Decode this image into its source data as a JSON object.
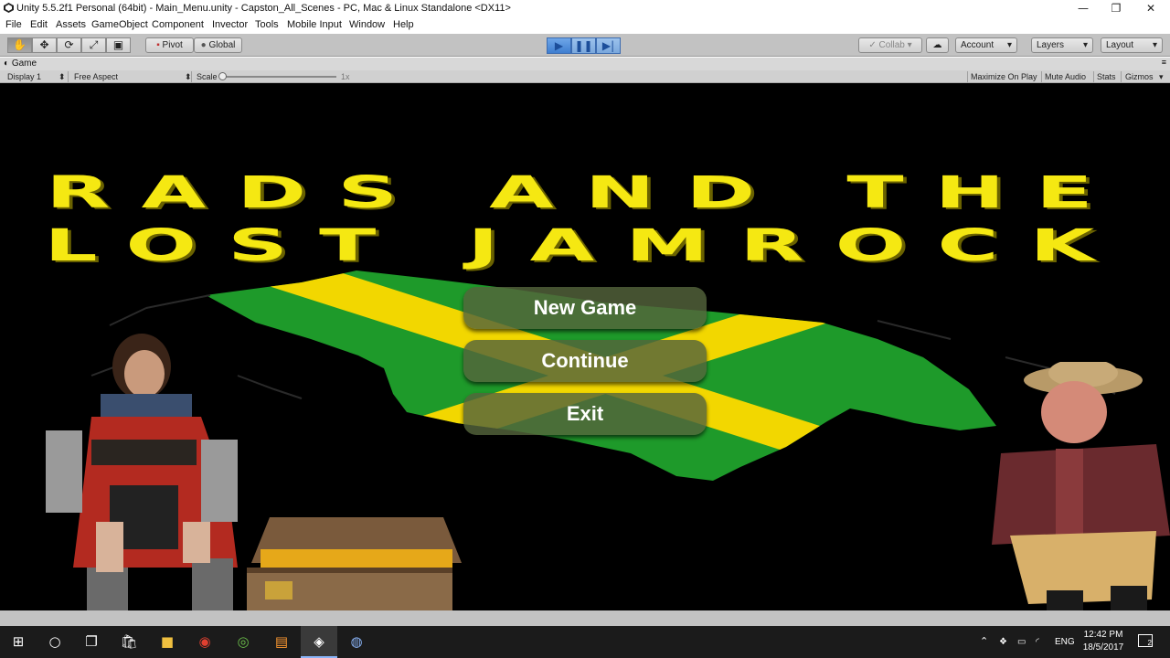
{
  "window": {
    "title": "Unity 5.5.2f1 Personal (64bit) - Main_Menu.unity - Capston_All_Scenes - PC, Mac & Linux Standalone <DX11>",
    "minimize_glyph": "—",
    "maximize_glyph": "❐",
    "close_glyph": "✕"
  },
  "menu": [
    "File",
    "Edit",
    "Assets",
    "GameObject",
    "Component",
    "Invector",
    "Tools",
    "Mobile Input",
    "Window",
    "Help"
  ],
  "toolbar": {
    "tools": [
      "✋",
      "✥",
      "⟳",
      "⤢",
      "▣"
    ],
    "pivot_label": "Pivot",
    "global_label": "Global",
    "play_glyph": "▶",
    "pause_glyph": "❚❚",
    "step_glyph": "▶|",
    "collab_label": "Collab ▾",
    "cloud_glyph": "☁",
    "account_label": "Account",
    "layers_label": "Layers",
    "layout_label": "Layout",
    "dropdown_glyph": "▾"
  },
  "game_view": {
    "tab_label": "Game",
    "display": "Display 1",
    "aspect": "Free Aspect",
    "scale_label": "Scale",
    "scale_value": "1x",
    "scale_level": 0,
    "maximize_on_play": "Maximize On Play",
    "mute_audio": "Mute Audio",
    "stats": "Stats",
    "gizmos": "Gizmos"
  },
  "game": {
    "title_line1": "RADS AND THE",
    "title_line2": "LOST JAMROCK",
    "buttons": {
      "new_game": "New Game",
      "continue": "Continue",
      "exit": "Exit"
    },
    "colors": {
      "title": "#f5e812",
      "flag_yellow": "#f2d700",
      "flag_green": "#1e9a2a",
      "button_bg": "#54643c"
    }
  },
  "taskbar": {
    "apps": [
      "start-icon",
      "cortana-icon",
      "task-view-icon",
      "store-icon",
      "file-explorer-icon",
      "chrome-icon",
      "app-icon",
      "sublime-icon",
      "unity-icon",
      "unity-hub-icon"
    ],
    "language": "ENG",
    "time": "12:42 PM",
    "date": "18/5/2017",
    "notification_count": "2"
  }
}
